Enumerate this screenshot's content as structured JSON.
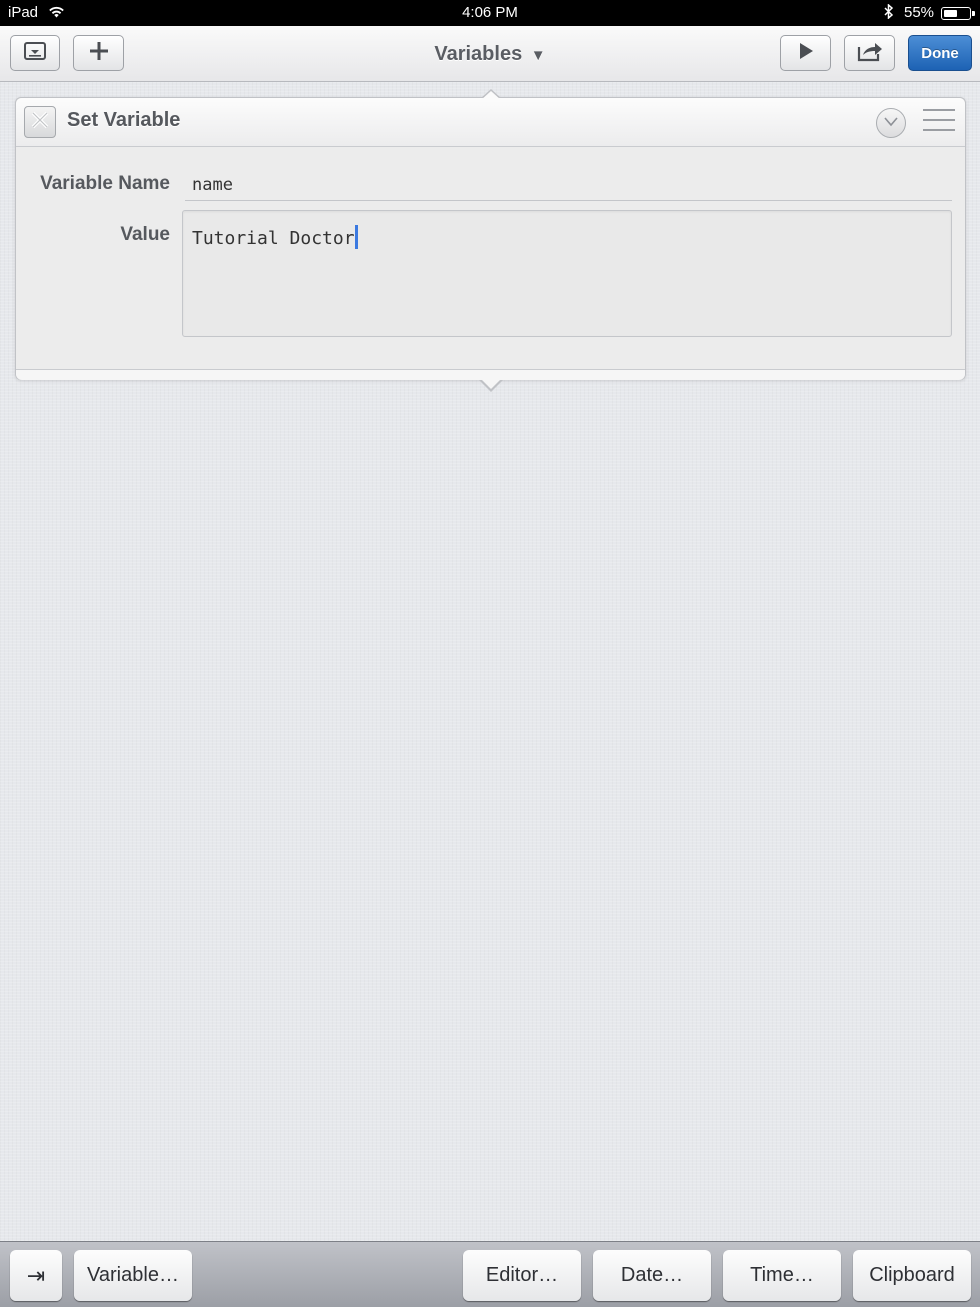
{
  "status_bar": {
    "device": "iPad",
    "time": "4:06 PM",
    "battery_percent": "55%",
    "battery_level": 0.55
  },
  "toolbar": {
    "title": "Variables",
    "done_label": "Done"
  },
  "action": {
    "title": "Set Variable",
    "variable_name_label": "Variable Name",
    "variable_name_value": "name",
    "value_label": "Value",
    "value_text": "Tutorial Doctor"
  },
  "accessory_bar": {
    "tab_key": "⇥",
    "variable_label": "Variable…",
    "editor_label": "Editor…",
    "date_label": "Date…",
    "time_label": "Time…",
    "clipboard_label": "Clipboard"
  }
}
